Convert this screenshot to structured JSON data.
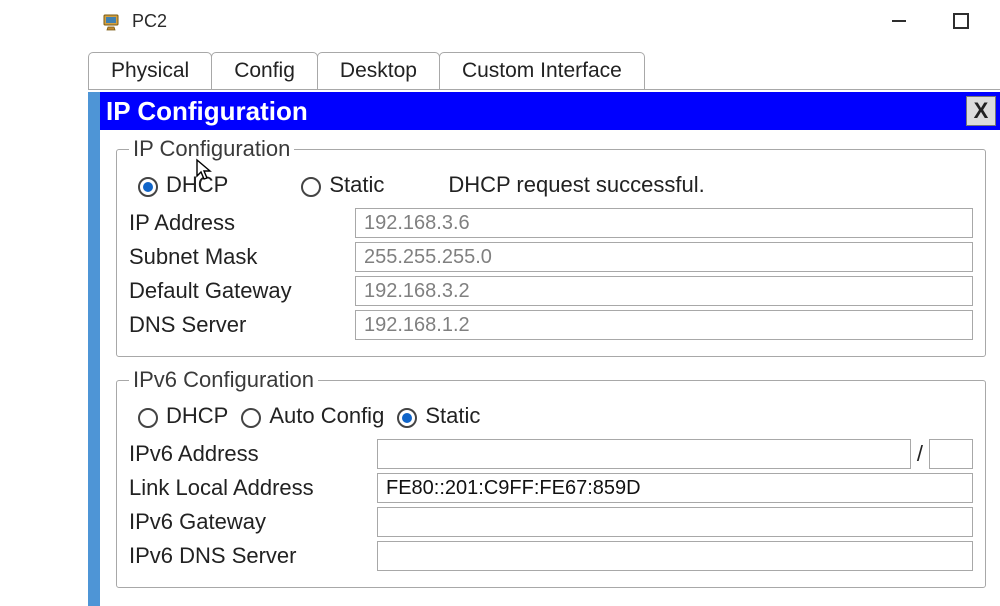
{
  "window": {
    "title": "PC2"
  },
  "tabs": {
    "physical": "Physical",
    "config": "Config",
    "desktop": "Desktop",
    "custom": "Custom Interface",
    "active": "desktop"
  },
  "panel": {
    "title": "IP Configuration",
    "close": "X"
  },
  "ipv4": {
    "legend": "IP Configuration",
    "mode": "dhcp",
    "dhcp_label": "DHCP",
    "static_label": "Static",
    "status": "DHCP request successful.",
    "ip_label": "IP Address",
    "ip_value": "192.168.3.6",
    "mask_label": "Subnet Mask",
    "mask_value": "255.255.255.0",
    "gw_label": "Default Gateway",
    "gw_value": "192.168.3.2",
    "dns_label": "DNS Server",
    "dns_value": "192.168.1.2"
  },
  "ipv6": {
    "legend": "IPv6 Configuration",
    "mode": "static",
    "dhcp_label": "DHCP",
    "auto_label": "Auto Config",
    "static_label": "Static",
    "addr_label": "IPv6 Address",
    "addr_value": "",
    "prefix_value": "",
    "slash": "/",
    "lla_label": "Link Local Address",
    "lla_value": "FE80::201:C9FF:FE67:859D",
    "gw_label": "IPv6 Gateway",
    "gw_value": "",
    "dns_label": "IPv6 DNS Server",
    "dns_value": ""
  }
}
